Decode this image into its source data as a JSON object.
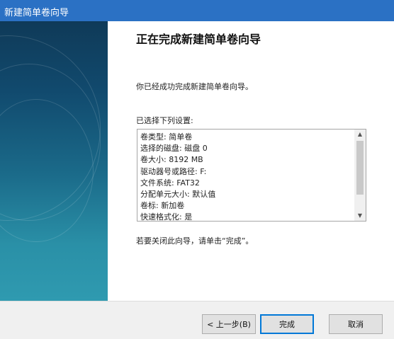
{
  "window": {
    "title": "新建简单卷向导"
  },
  "heading": "正在完成新建简单卷向导",
  "success_text": "你已经成功完成新建简单卷向导。",
  "settings_label": "已选择下列设置:",
  "settings_list": [
    "卷类型: 简单卷",
    "选择的磁盘: 磁盘 0",
    "卷大小: 8192 MB",
    "驱动器号或路径: F:",
    "文件系统: FAT32",
    "分配单元大小: 默认值",
    "卷标: 新加卷",
    "快速格式化: 是"
  ],
  "close_hint": "若要关闭此向导，请单击“完成”。",
  "buttons": {
    "back": "< 上一步(B)",
    "finish": "完成",
    "cancel": "取消"
  },
  "scrollbar": {
    "up": "▲",
    "down": "▼"
  },
  "colors": {
    "title_bar": "#2b71c4",
    "accent": "#0078d7",
    "side_panel": "#1b6b8a"
  }
}
